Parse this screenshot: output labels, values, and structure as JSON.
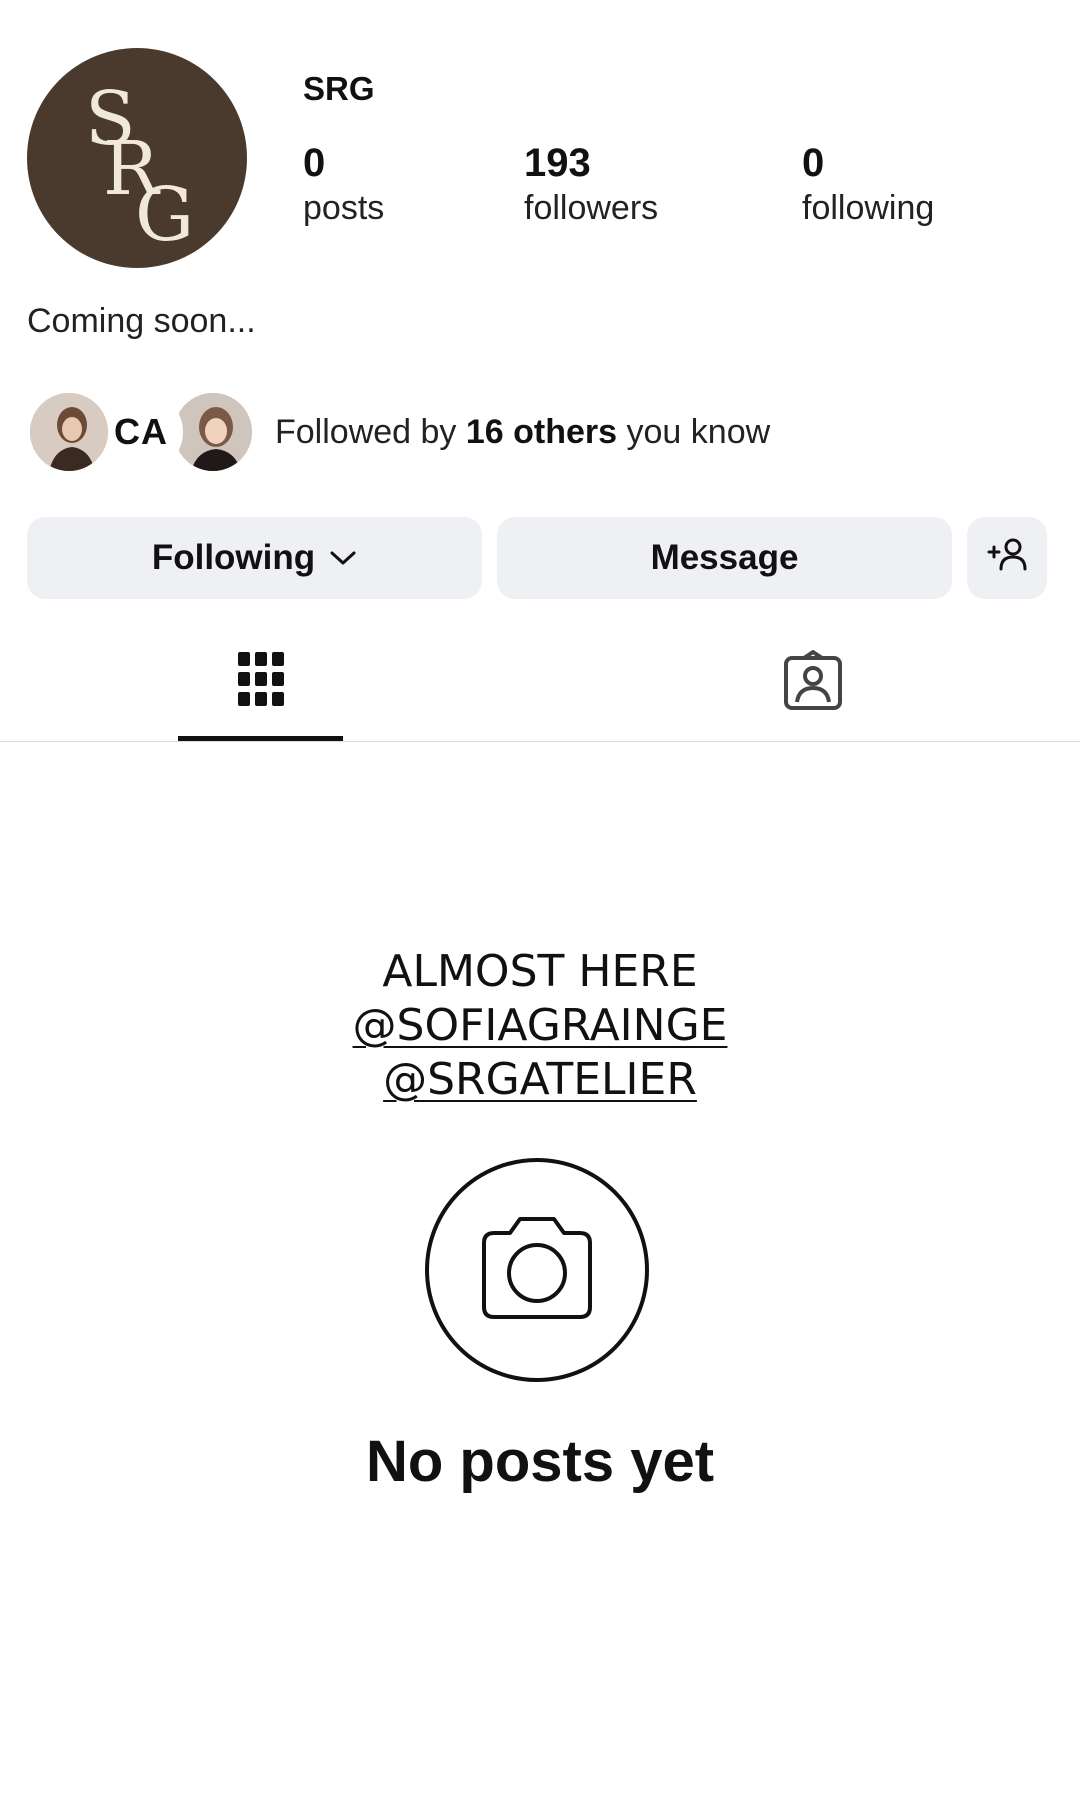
{
  "profile": {
    "username": "SRG",
    "avatar_monogram": "SRG",
    "avatar_color": "#4a3a2e",
    "bio": "Coming soon..."
  },
  "stats": {
    "posts": {
      "value": "0",
      "label": "posts"
    },
    "followers": {
      "value": "193",
      "label": "followers"
    },
    "following": {
      "value": "0",
      "label": "following"
    }
  },
  "mutuals": {
    "prefix": "Followed by",
    "highlight": "16 others",
    "suffix": "you know",
    "badge_text": "CA"
  },
  "actions": {
    "following_label": "Following",
    "message_label": "Message",
    "add_icon": "add-person-icon"
  },
  "tabs": {
    "grid_icon": "grid-icon",
    "tagged_icon": "tagged-icon",
    "active": "grid"
  },
  "story": {
    "line1": "ALMOST HERE",
    "line2": "@SOFIAGRAINGE",
    "line3": "@SRGATELIER"
  },
  "empty_state": {
    "icon": "camera-icon",
    "title": "No posts yet"
  }
}
